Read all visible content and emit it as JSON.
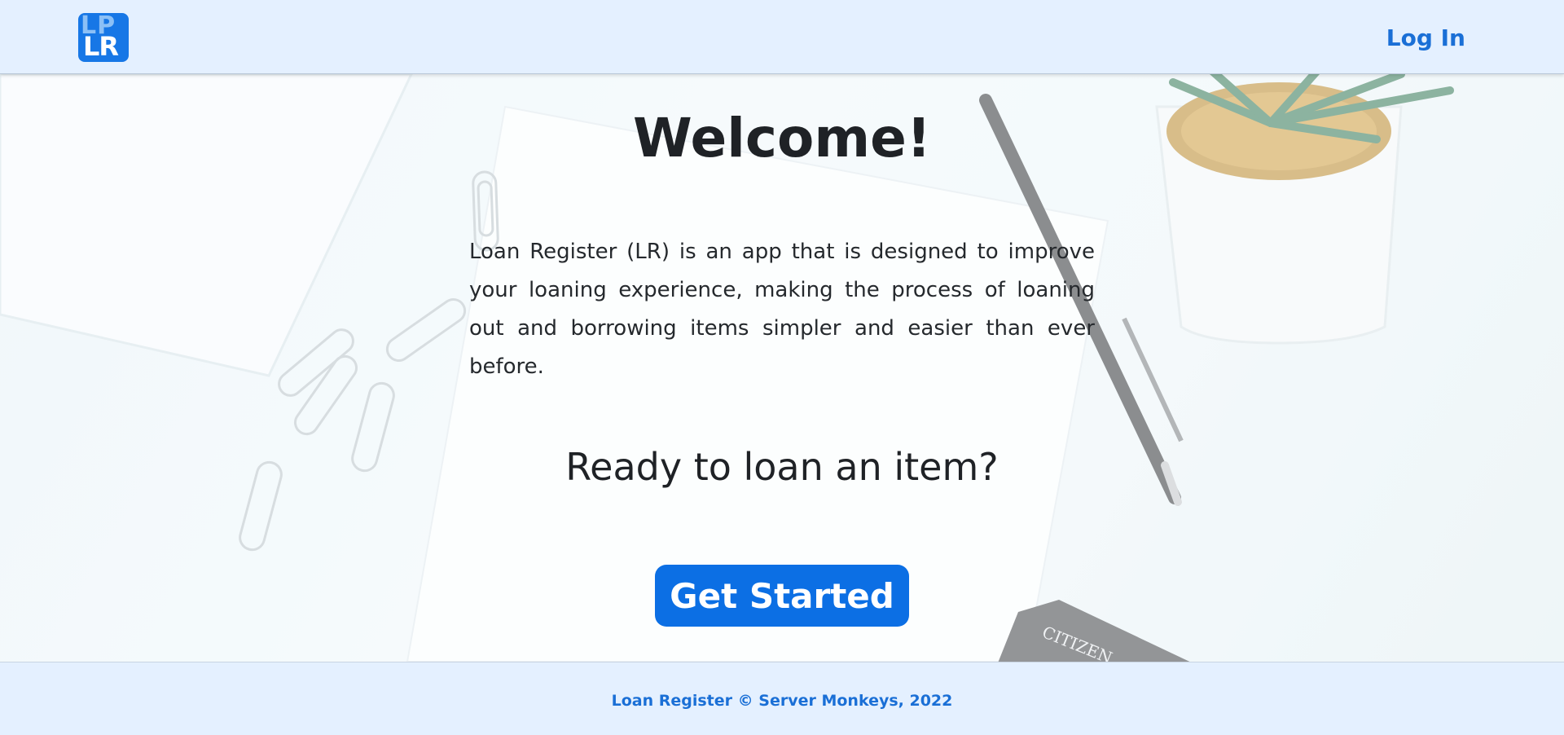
{
  "header": {
    "logo_text_top": "LP",
    "logo_text_bottom": "LR",
    "login_label": "Log In"
  },
  "hero": {
    "title": "Welcome!",
    "intro": "Loan Register (LR) is an app that is designed to improve your loaning experience, making the process of loaning out and borrowing items simpler and easier than ever before.",
    "prompt": "Ready to loan an item?",
    "cta_label": "Get Started",
    "background_brand_text": "CITIZEN"
  },
  "footer": {
    "text": "Loan Register © Server Monkeys, 2022"
  },
  "colors": {
    "accent": "#0c6fe4",
    "link": "#1a6fd6",
    "header_bg": "#e4f0ff",
    "text": "#1f2226"
  },
  "icons": {
    "logo": "lr-logo-icon"
  }
}
